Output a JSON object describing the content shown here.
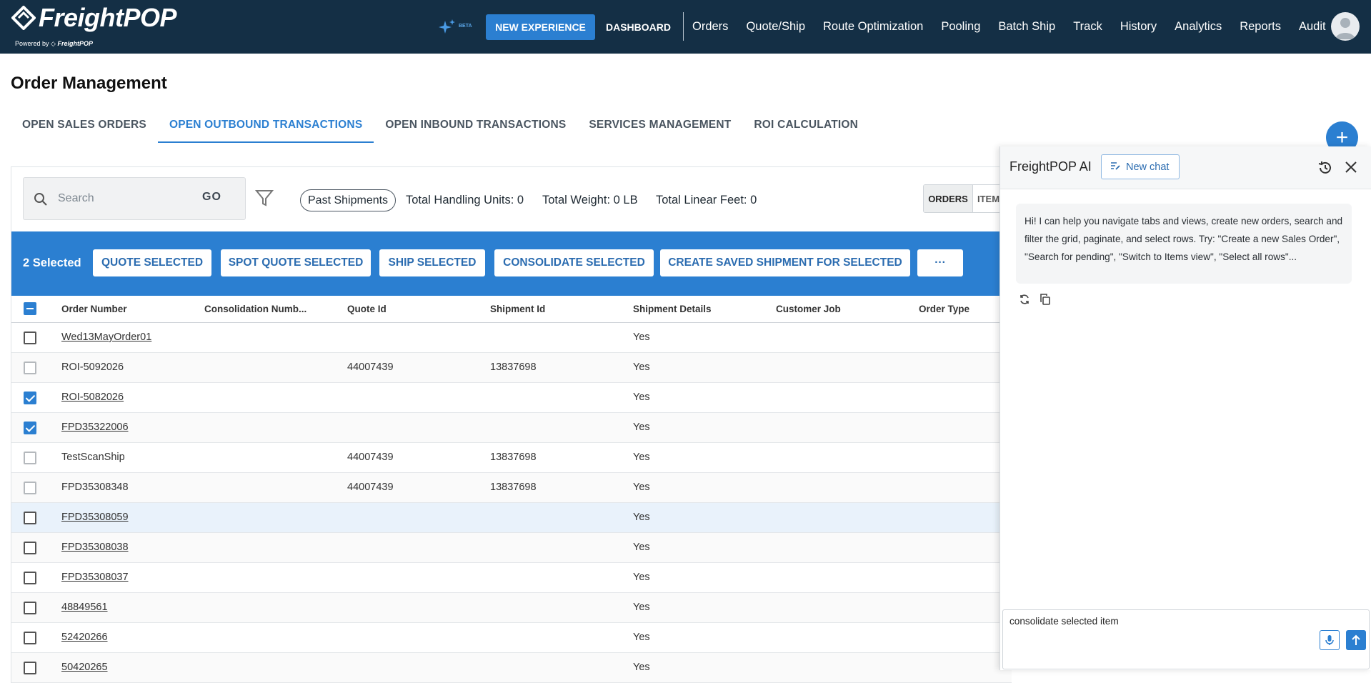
{
  "app": {
    "logo_text": "FreightPOP",
    "powered_by_prefix": "Powered by",
    "powered_by_brand": "FreightPOP",
    "beta_label": "BETA",
    "new_experience_label": "NEW EXPERIENCE",
    "dashboard_label": "DASHBOARD",
    "nav_links": [
      "Orders",
      "Quote/Ship",
      "Route Optimization",
      "Pooling",
      "Batch Ship",
      "Track",
      "History",
      "Analytics",
      "Reports",
      "Audit"
    ],
    "colors": {
      "topbar": "#142f45",
      "accent": "#2b7fd1"
    }
  },
  "page": {
    "title": "Order Management",
    "tabs": [
      {
        "label": "OPEN SALES ORDERS",
        "active": false
      },
      {
        "label": "OPEN OUTBOUND TRANSACTIONS",
        "active": true
      },
      {
        "label": "OPEN INBOUND TRANSACTIONS",
        "active": false
      },
      {
        "label": "SERVICES MANAGEMENT",
        "active": false
      },
      {
        "label": "ROI CALCULATION",
        "active": false
      }
    ],
    "fab_label": "+"
  },
  "toolbar": {
    "search_placeholder": "Search",
    "go_label": "GO",
    "chip_label": "Past Shipments",
    "total_handling_units": "Total Handling Units: 0",
    "total_weight": "Total Weight: 0 LB",
    "total_linear_feet": "Total Linear Feet: 0",
    "view_orders": "ORDERS",
    "view_items": "ITEMS"
  },
  "selection_bar": {
    "count_label": "2 Selected",
    "buttons": [
      "QUOTE SELECTED",
      "SPOT QUOTE SELECTED",
      "SHIP SELECTED",
      "CONSOLIDATE SELECTED",
      "CREATE SAVED SHIPMENT FOR SELECTED",
      "···"
    ]
  },
  "grid": {
    "columns": [
      "Order Number",
      "Consolidation Numb...",
      "Quote Id",
      "Shipment Id",
      "Shipment Details",
      "Customer Job",
      "Order Type"
    ],
    "rows": [
      {
        "order": "Wed13MayOrder01",
        "link": true,
        "quote": "",
        "shipment": "",
        "details": "Yes",
        "state": "empty"
      },
      {
        "order": "ROI-5092026",
        "link": false,
        "quote": "44007439",
        "shipment": "13837698",
        "details": "Yes",
        "state": "disabled"
      },
      {
        "order": "ROI-5082026",
        "link": true,
        "quote": "",
        "shipment": "",
        "details": "Yes",
        "state": "checked"
      },
      {
        "order": "FPD35322006",
        "link": true,
        "quote": "",
        "shipment": "",
        "details": "Yes",
        "state": "checked"
      },
      {
        "order": "TestScanShip",
        "link": false,
        "quote": "44007439",
        "shipment": "13837698",
        "details": "Yes",
        "state": "disabled"
      },
      {
        "order": "FPD35308348",
        "link": false,
        "quote": "44007439",
        "shipment": "13837698",
        "details": "Yes",
        "state": "disabled"
      },
      {
        "order": "FPD35308059",
        "link": true,
        "quote": "",
        "shipment": "",
        "details": "Yes",
        "state": "empty",
        "highlight": true
      },
      {
        "order": "FPD35308038",
        "link": true,
        "quote": "",
        "shipment": "",
        "details": "Yes",
        "state": "empty"
      },
      {
        "order": "FPD35308037",
        "link": true,
        "quote": "",
        "shipment": "",
        "details": "Yes",
        "state": "empty"
      },
      {
        "order": "48849561",
        "link": true,
        "quote": "",
        "shipment": "",
        "details": "Yes",
        "state": "empty"
      },
      {
        "order": "52420266",
        "link": true,
        "quote": "",
        "shipment": "",
        "details": "Yes",
        "state": "empty"
      },
      {
        "order": "50420265",
        "link": true,
        "quote": "",
        "shipment": "",
        "details": "Yes",
        "state": "empty"
      }
    ]
  },
  "ai_panel": {
    "title": "FreightPOP AI",
    "new_chat_label": "New chat",
    "message": "Hi! I can help you navigate tabs and views, create new orders, search and filter the grid, paginate, and select rows. Try: \"Create a new Sales Order\", \"Search for pending\", \"Switch to Items view\", \"Select all rows\"...",
    "input_value": "consolidate selected item"
  }
}
